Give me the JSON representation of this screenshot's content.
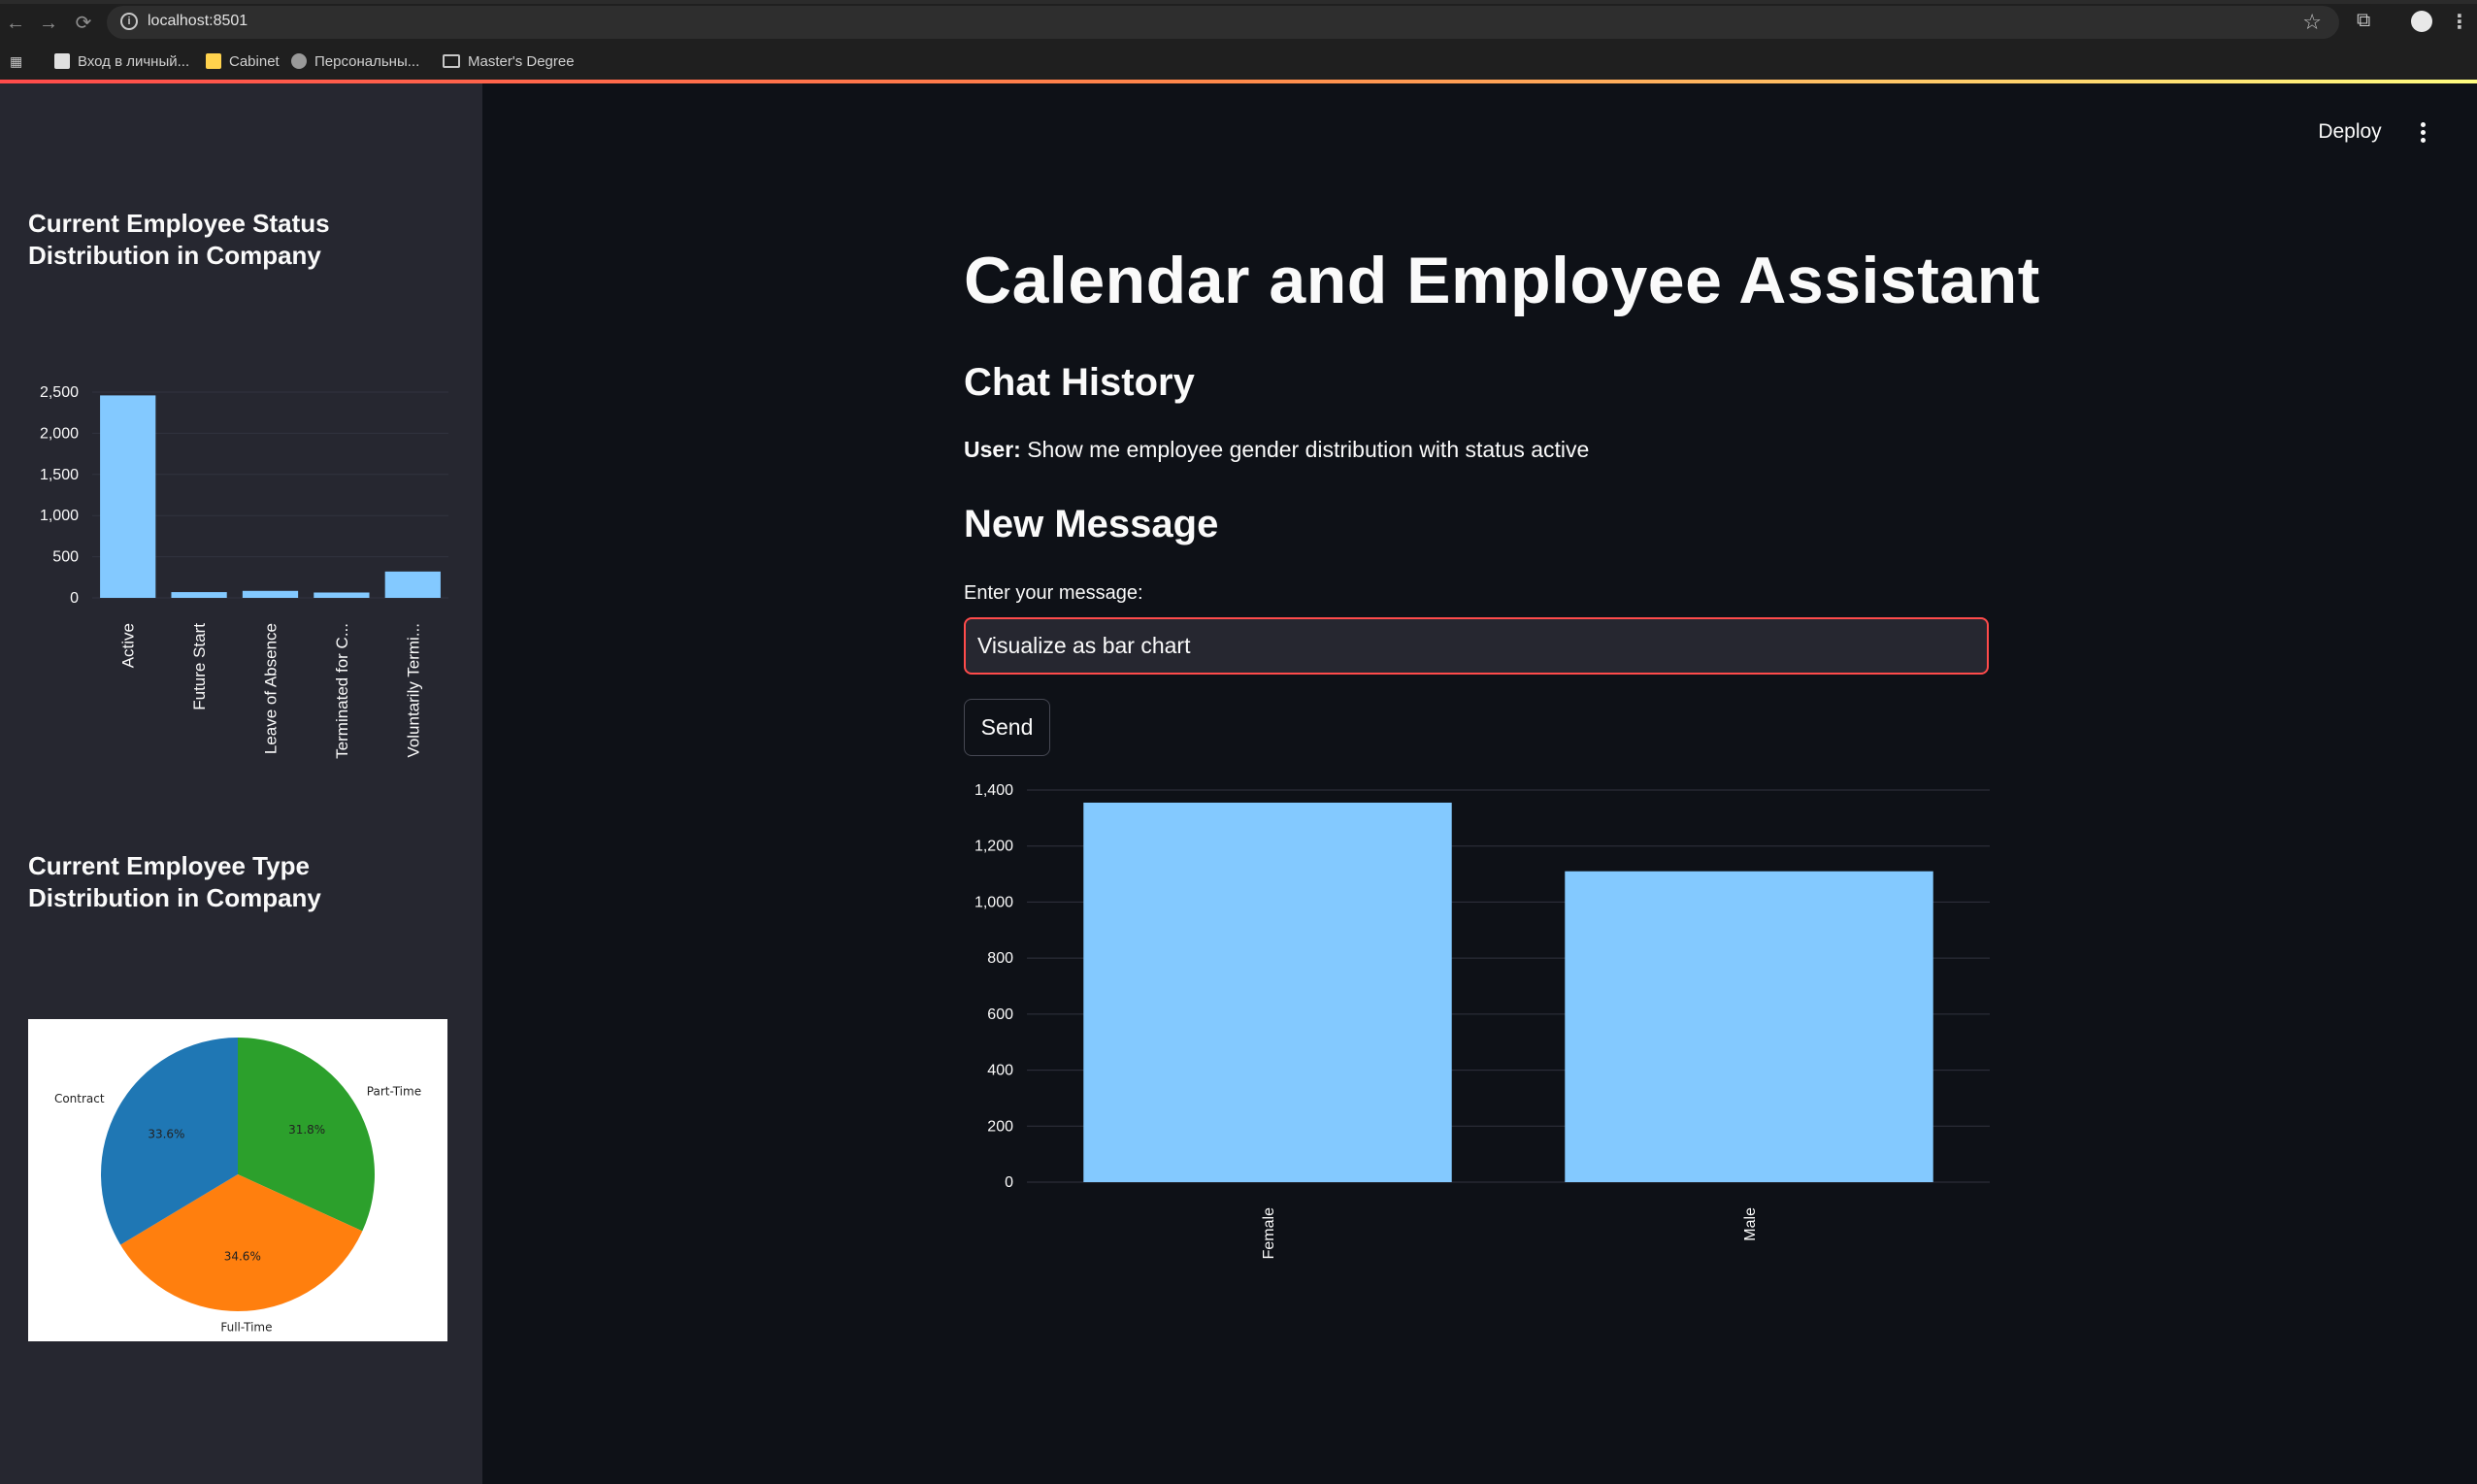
{
  "browser": {
    "url": "localhost:8501",
    "bookmarks": [
      {
        "label": "Вход в личный..."
      },
      {
        "label": "Cabinet"
      },
      {
        "label": "Персональны..."
      },
      {
        "label": "Master's Degree"
      }
    ]
  },
  "header": {
    "deploy_label": "Deploy"
  },
  "sidebar": {
    "status_title": "Current Employee Status Distribution in Company",
    "type_title": "Current Employee Type Distribution in Company"
  },
  "main": {
    "title": "Calendar and Employee Assistant",
    "chat_history_title": "Chat History",
    "chat": {
      "speaker": "User:",
      "text": " Show me employee gender distribution with status active"
    },
    "new_message_title": "New Message",
    "input_label": "Enter your message:",
    "input_value": "Visualize as bar chart",
    "send_label": "Send"
  },
  "colors": {
    "bar": "#83c9ff",
    "accent": "#ff4b4b",
    "grid": "#31333f"
  },
  "chart_data": [
    {
      "type": "bar",
      "title": "Current Employee Status Distribution in Company",
      "categories": [
        "Active",
        "Future Start",
        "Leave of Absence",
        "Terminated for C...",
        "Voluntarily Termi..."
      ],
      "values": [
        2460,
        70,
        85,
        65,
        320
      ],
      "ylim": [
        0,
        2500
      ],
      "yticks": [
        0,
        500,
        1000,
        1500,
        2000,
        2500
      ],
      "ytick_labels": [
        "0",
        "500",
        "1,000",
        "1,500",
        "2,000",
        "2,500"
      ]
    },
    {
      "type": "pie",
      "title": "Current Employee Type Distribution in Company",
      "labels": [
        "Contract",
        "Part-Time",
        "Full-Time"
      ],
      "values": [
        33.6,
        31.8,
        34.6
      ],
      "value_labels": [
        "33.6%",
        "31.8%",
        "34.6%"
      ],
      "colors": [
        "#1f77b4",
        "#2ca02c",
        "#ff7f0e"
      ]
    },
    {
      "type": "bar",
      "categories": [
        "Female",
        "Male"
      ],
      "values": [
        1355,
        1110
      ],
      "ylim": [
        0,
        1400
      ],
      "yticks": [
        0,
        200,
        400,
        600,
        800,
        1000,
        1200,
        1400
      ],
      "ytick_labels": [
        "0",
        "200",
        "400",
        "600",
        "800",
        "1,000",
        "1,200",
        "1,400"
      ]
    }
  ]
}
